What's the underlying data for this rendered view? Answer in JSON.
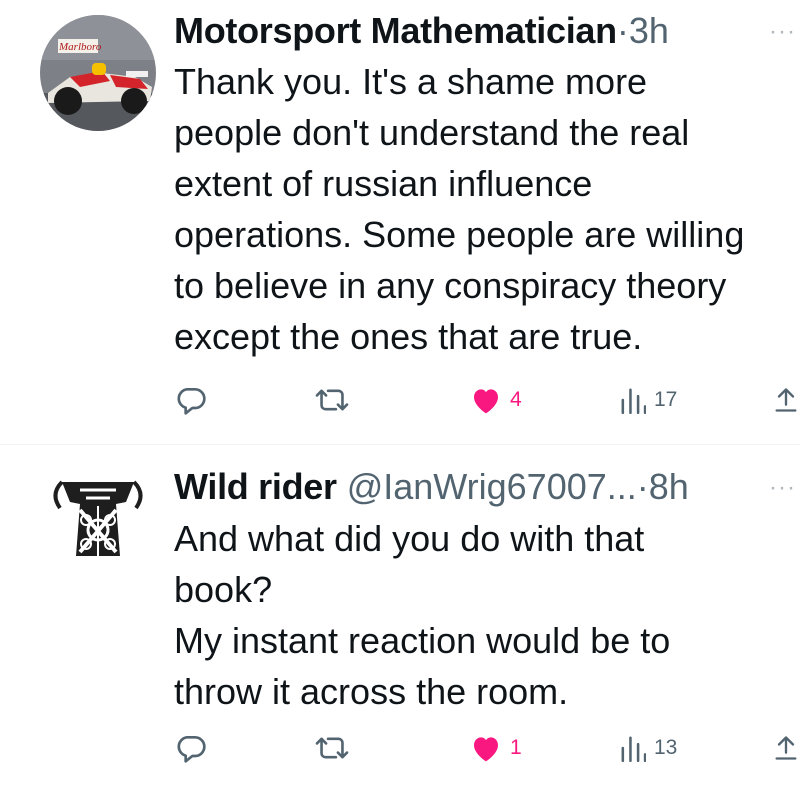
{
  "tweets": [
    {
      "name": "Motorsport Mathematician",
      "handle": "",
      "separator": "·",
      "time": "3h",
      "more": "···",
      "text": "Thank you. It's a shame more\npeople don't understand the real\nextent of russian influence\noperations. Some people are willing\nto believe in any conspiracy theory\nexcept the ones that are true.",
      "likes": "4",
      "views": "17",
      "avatar_logo_text": "Marlboro"
    },
    {
      "name": "Wild rider",
      "handle": "@IanWrig67007...",
      "separator": "·",
      "time": "8h",
      "more": "···",
      "text": "And what did you do with that\nbook?\nMy instant reaction would be to\nthrow it across the room.",
      "likes": "1",
      "views": "13"
    }
  ],
  "icons": {
    "reply": "reply-icon",
    "retweet": "retweet-icon",
    "like": "heart-filled-icon",
    "views": "views-icon",
    "share": "share-icon"
  },
  "colors": {
    "like": "#f91880",
    "icon": "#536471",
    "text": "#0f1419"
  }
}
